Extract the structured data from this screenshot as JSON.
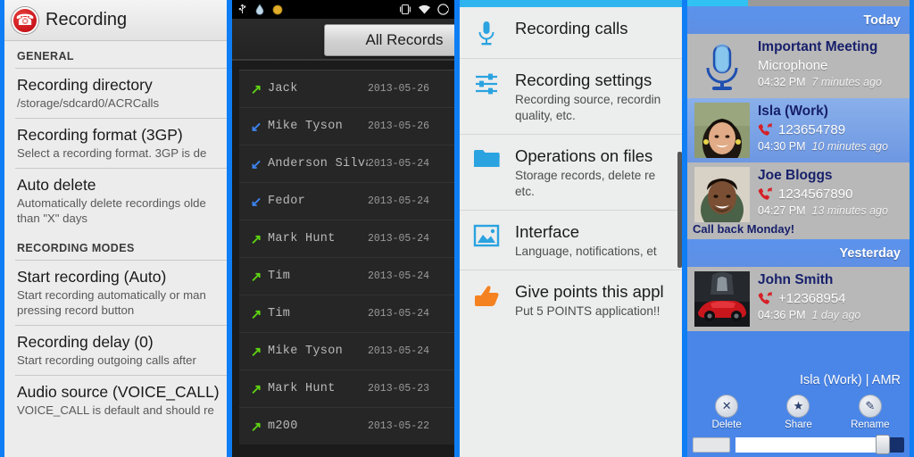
{
  "panel1": {
    "app_title": "Recording",
    "app_icon": "phone-record-icon",
    "sections": [
      {
        "header": "GENERAL",
        "items": [
          {
            "title": "Recording directory",
            "summary": "/storage/sdcard0/ACRCalls"
          },
          {
            "title": "Recording format (3GP)",
            "summary": "Select a recording format. 3GP is de"
          },
          {
            "title": "Auto delete",
            "summary": "Automatically delete recordings olde",
            "summary2": "than \"X\" days"
          }
        ]
      },
      {
        "header": "RECORDING MODES",
        "items": [
          {
            "title": "Start recording (Auto)",
            "summary": "Start recording automatically or man",
            "summary2": "pressing record button"
          },
          {
            "title": "Recording delay (0)",
            "summary": "Start recording outgoing calls after"
          },
          {
            "title": "Audio source (VOICE_CALL)",
            "summary": "VOICE_CALL is default and should re"
          }
        ]
      }
    ]
  },
  "panel2": {
    "status_icons": [
      "usb-icon",
      "water-drop-icon",
      "circle-icon"
    ],
    "status_icons_right": [
      "vibrate-icon",
      "wifi-icon",
      "battery-icon"
    ],
    "tab_label": "All Records",
    "rows": [
      {
        "direction": "out",
        "arrow": "↗",
        "name": "Jack",
        "date": "2013-05-26"
      },
      {
        "direction": "in",
        "arrow": "↙",
        "name": "Mike Tyson",
        "date": "2013-05-26"
      },
      {
        "direction": "in",
        "arrow": "↙",
        "name": "Anderson Silva",
        "date": "2013-05-24"
      },
      {
        "direction": "in",
        "arrow": "↙",
        "name": "Fedor",
        "date": "2013-05-24"
      },
      {
        "direction": "out",
        "arrow": "↗",
        "name": "Mark Hunt",
        "date": "2013-05-24"
      },
      {
        "direction": "out",
        "arrow": "↗",
        "name": "Tim",
        "date": "2013-05-24"
      },
      {
        "direction": "out",
        "arrow": "↗",
        "name": "Tim",
        "date": "2013-05-24"
      },
      {
        "direction": "out",
        "arrow": "↗",
        "name": "Mike Tyson",
        "date": "2013-05-24"
      },
      {
        "direction": "out",
        "arrow": "↗",
        "name": "Mark Hunt",
        "date": "2013-05-23"
      },
      {
        "direction": "out",
        "arrow": "↗",
        "name": "m200",
        "date": "2013-05-22"
      }
    ]
  },
  "panel3": {
    "items": [
      {
        "icon": "microphone-icon",
        "title": "Recording calls",
        "summary": ""
      },
      {
        "icon": "sliders-icon",
        "title": "Recording settings",
        "summary": "Recording source, recordin",
        "summary2": "quality, etc."
      },
      {
        "icon": "folder-icon",
        "title": "Operations on files",
        "summary": "Storage records, delete re",
        "summary2": "etc."
      },
      {
        "icon": "image-icon",
        "title": "Interface",
        "summary": "Language, notifications, et"
      },
      {
        "icon": "thumbs-up-icon",
        "title": "Give points this appl",
        "summary": "Put 5 POINTS application!!"
      }
    ]
  },
  "panel4": {
    "groups": [
      {
        "header": "Today",
        "calls": [
          {
            "avatar": "microphone-avatar",
            "name": "Important Meeting",
            "number": "Microphone",
            "number_is_text": true,
            "time": "04:32 PM",
            "ago": "7 minutes ago",
            "style": "gray",
            "note": ""
          },
          {
            "avatar": "woman-photo",
            "name": "Isla (Work)",
            "number": "123654789",
            "time": "04:30 PM",
            "ago": "10 minutes ago",
            "style": "blue",
            "note": ""
          },
          {
            "avatar": "man-photo",
            "name": "Joe Bloggs",
            "number": "1234567890",
            "time": "04:27 PM",
            "ago": "13 minutes ago",
            "style": "gray",
            "note": "Call back Monday!"
          }
        ]
      },
      {
        "header": "Yesterday",
        "calls": [
          {
            "avatar": "car-photo",
            "name": "John Smith",
            "number": "+12368954",
            "time": "04:36 PM",
            "ago": "1 day ago",
            "style": "gray",
            "note": ""
          }
        ]
      }
    ],
    "now_playing": "Isla (Work) | AMR",
    "actions": [
      {
        "icon": "close-icon",
        "glyph": "✕",
        "label": "Delete"
      },
      {
        "icon": "star-icon",
        "glyph": "★",
        "label": "Share"
      },
      {
        "icon": "rename-icon",
        "glyph": "✎",
        "label": "Rename"
      }
    ]
  },
  "colors": {
    "frame_blue": "#0f7ef5",
    "accent_blue": "#2fb4f0",
    "outgoing_green": "#5fd412",
    "incoming_blue": "#3d84f0",
    "orange": "#f58220",
    "record_red": "#c9131b"
  }
}
